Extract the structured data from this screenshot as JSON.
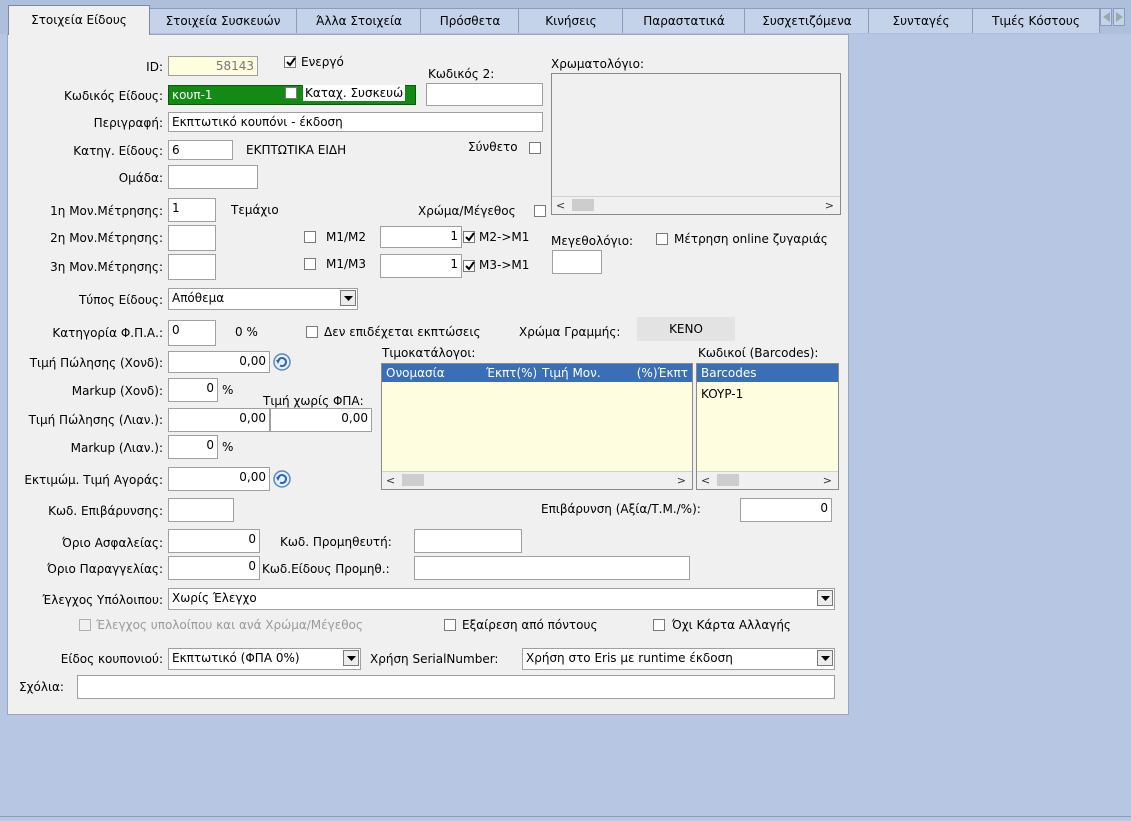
{
  "tabs": [
    {
      "label": "Στοιχεία Είδους",
      "active": true
    },
    {
      "label": "Στοιχεία Συσκευών"
    },
    {
      "label": "Άλλα Στοιχεία"
    },
    {
      "label": "Πρόσθετα"
    },
    {
      "label": "Κινήσεις"
    },
    {
      "label": "Παραστατικά"
    },
    {
      "label": "Συσχετιζόμενα"
    },
    {
      "label": "Συνταγές"
    },
    {
      "label": "Τιμές Κόστους"
    }
  ],
  "form": {
    "id_label": "ID:",
    "id_value": "58143",
    "active_label": "Ενεργό",
    "active_checked": true,
    "code2_label": "Κωδικός 2:",
    "code2_value": "",
    "color_palette_label": "Χρωματολόγιο:",
    "item_code_label": "Κωδικός Είδους:",
    "item_code_value": "κουπ-1",
    "device_cat_label": "Καταχ. Συσκευώ",
    "description_label": "Περιγραφή:",
    "description_value": "Εκπτωτικό κουπόνι - έκδοση",
    "category_label": "Κατηγ. Είδους:",
    "category_value": "6",
    "category_name": "ΕΚΠΤΩΤΙΚΑ ΕΙΔΗ",
    "composite_label": "Σύνθετο",
    "group_label": "Ομάδα:",
    "group_value": "",
    "unit1_label": "1η Μον.Μέτρησης:",
    "unit1_value": "1",
    "unit1_name": "Τεμάχιο",
    "color_size_label": "Χρώμα/Μέγεθος",
    "unit2_label": "2η Μον.Μέτρησης:",
    "unit2_value": "",
    "m1m2_label": "M1/M2",
    "m1m2_value": "1",
    "m2m1_label": "M2->M1",
    "size_palette_label": "Μεγεθολόγιο:",
    "online_scale_label": "Μέτρηση online ζυγαριάς",
    "unit3_label": "3η Μον.Μέτρησης:",
    "unit3_value": "",
    "m1m3_label": "M1/M3",
    "m1m3_value": "1",
    "m3m1_label": "M3->M1",
    "item_type_label": "Τύπος Είδους:",
    "item_type_value": "Απόθεμα",
    "vat_cat_label": "Κατηγορία Φ.Π.Α.:",
    "vat_cat_value": "0",
    "vat_pct": "0 %",
    "no_discount_label": "Δεν επιδέχεται εκπτώσεις",
    "row_color_label": "Χρώμα Γραμμής:",
    "row_color_value": "ΚΕΝΟ",
    "wholesale_price_label": "Τιμή Πώλησης (Χονδ):",
    "wholesale_price_value": "0,00",
    "pricelists_label": "Τιμοκατάλογοι:",
    "barcodes_label": "Κωδικοί (Barcodes):",
    "markup_wholesale_label": "Markup (Χονδ):",
    "markup_wholesale_value": "0",
    "pct_sign": "%",
    "price_no_vat_label": "Τιμή χωρίς ΦΠΑ:",
    "retail_price_label": "Τιμή Πώλησης (Λιαν.):",
    "retail_price_value": "0,00",
    "price_no_vat_value": "0,00",
    "markup_retail_label": "Markup (Λιαν.):",
    "markup_retail_value": "0",
    "est_purchase_label": "Εκτιμώμ. Τιμή Αγοράς:",
    "est_purchase_value": "0,00",
    "surcharge_code_label": "Κωδ. Επιβάρυνσης:",
    "surcharge_code_value": "",
    "surcharge_label": "Επιβάρυνση (Αξία/Τ.Μ./%):",
    "surcharge_value": "0",
    "safety_limit_label": "Όριο Ασφαλείας:",
    "safety_limit_value": "0",
    "supplier_code_label": "Κωδ. Προμηθευτή:",
    "supplier_code_value": "",
    "order_limit_label": "Όριο Παραγγελίας:",
    "order_limit_value": "0",
    "supplier_item_code_label": "Κωδ.Είδους Προμηθ.:",
    "supplier_item_code_value": "",
    "balance_check_label": "Έλεγχος Υπόλοιπου:",
    "balance_check_value": "Χωρίς Έλεγχο",
    "balance_per_color_label": "Έλεγχος υπολοίπου και ανά Χρώμα/Μέγεθος",
    "exclude_points_label": "Εξαίρεση από πόντους",
    "no_exchange_card_label": "Όχι Κάρτα Αλλαγής",
    "coupon_type_label": "Είδος κουπονιού:",
    "coupon_type_value": "Εκπτωτικό (ΦΠΑ 0%)",
    "serial_usage_label": "Χρήση SerialNumber:",
    "serial_usage_value": "Χρήση στο Eris με runtime έκδοση",
    "comments_label": "Σχόλια:",
    "comments_value": ""
  },
  "pricelists": {
    "columns": [
      "Ονομασία",
      "Έκπτ(%)",
      "Τιμή Μον.",
      "Έκπτ(%)"
    ],
    "rows": []
  },
  "barcodes": {
    "columns": [
      "Barcodes"
    ],
    "rows": [
      "KOYP-1"
    ]
  },
  "colors": {
    "item_code_bg": "#138a13",
    "header_bg": "#3a6fb8",
    "list_bg": "#fffde0"
  }
}
